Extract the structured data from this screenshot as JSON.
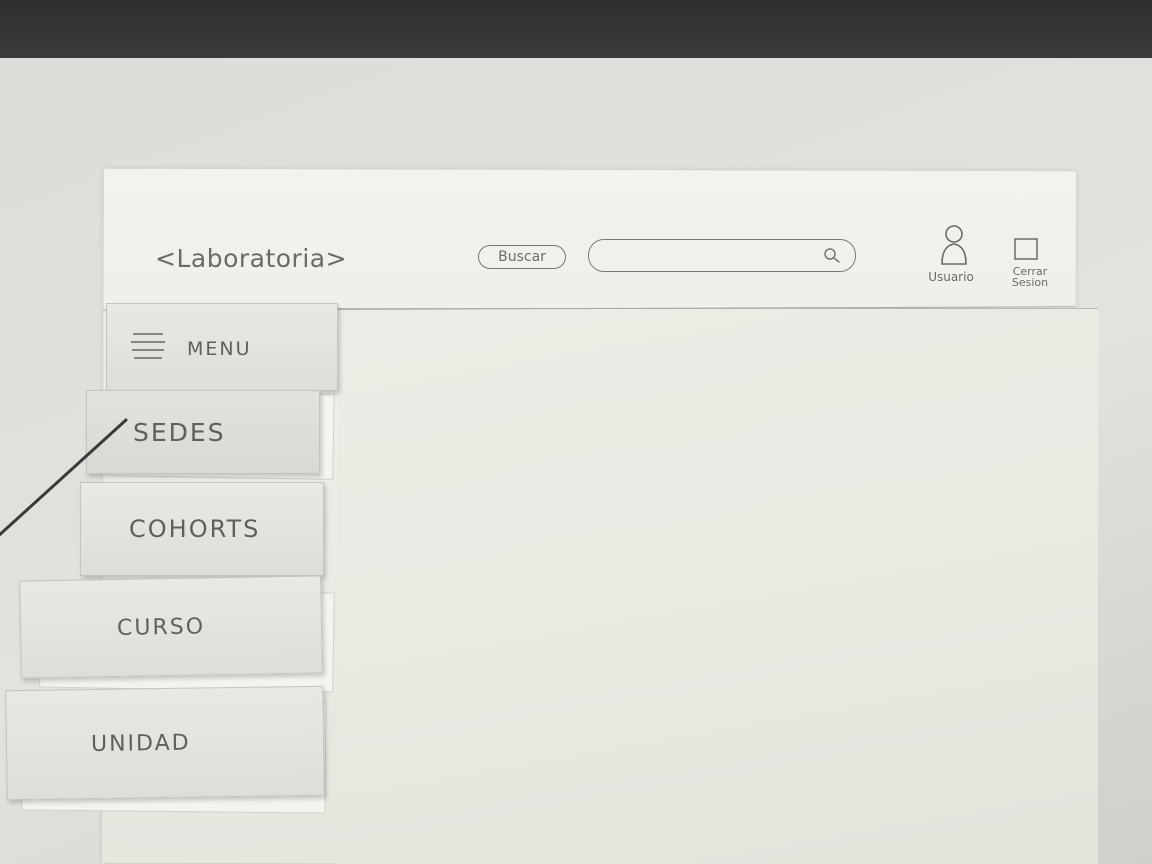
{
  "header": {
    "logo": "<Laboratoria>",
    "search_label": "Buscar",
    "search_value": "",
    "search_placeholder": "",
    "user_label": "Usuario",
    "logout_label_line1": "Cerrar",
    "logout_label_line2": "Sesion"
  },
  "icons": {
    "search": "search-icon",
    "user": "user-icon",
    "logout": "logout-icon",
    "menu": "hamburger-icon"
  },
  "sidebar": {
    "menu_label": "MENU",
    "items": [
      {
        "label": "SEDES"
      },
      {
        "label": "COHORTS"
      },
      {
        "label": "CURSO"
      },
      {
        "label": "UNIDAD"
      }
    ]
  },
  "colors": {
    "pencil": "#6a6a68",
    "paper": "#ededE7",
    "backdrop": "#2c2e2f"
  }
}
